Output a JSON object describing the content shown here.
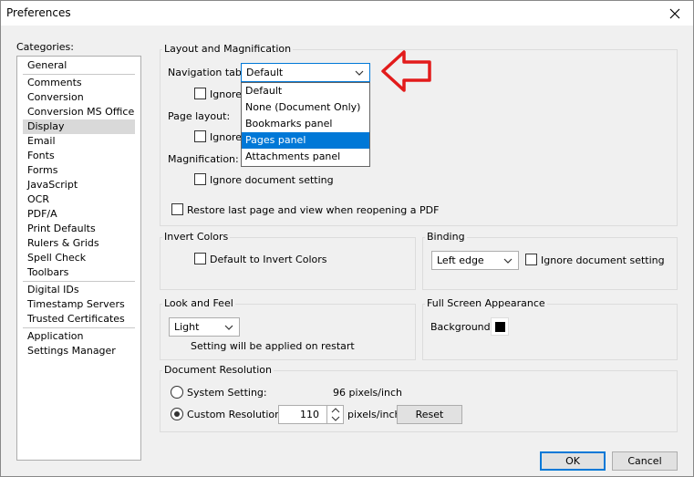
{
  "window": {
    "title": "Preferences"
  },
  "categories": {
    "label": "Categories:",
    "items": [
      "General",
      "Comments",
      "Conversion",
      "Conversion MS Office",
      "Display",
      "Email",
      "Fonts",
      "Forms",
      "JavaScript",
      "OCR",
      "PDF/A",
      "Print Defaults",
      "Rulers & Grids",
      "Spell Check",
      "Toolbars",
      "Digital IDs",
      "Timestamp Servers",
      "Trusted Certificates",
      "Application",
      "Settings Manager"
    ]
  },
  "layout": {
    "title": "Layout and Magnification",
    "nav_label": "Navigation tab:",
    "nav_value": "Default",
    "ignore_text": "Ignore",
    "page_layout_label": "Page layout:",
    "magnification_label": "Magnification:",
    "ignore_doc": "Ignore document setting",
    "restore": "Restore last page and view when reopening a PDF"
  },
  "nav_dropdown": {
    "options": [
      "Default",
      "None (Document Only)",
      "Bookmarks panel",
      "Pages panel",
      "Attachments panel"
    ],
    "selected": "Pages panel"
  },
  "invert": {
    "title": "Invert Colors",
    "label": "Default to Invert Colors"
  },
  "binding": {
    "title": "Binding",
    "value": "Left edge",
    "ignore": "Ignore document setting"
  },
  "look": {
    "title": "Look and Feel",
    "value": "Light",
    "note": "Setting will be applied on restart"
  },
  "fullscreen": {
    "title": "Full Screen Appearance",
    "background_label": "Background:",
    "background_color": "#000000"
  },
  "resolution": {
    "title": "Document Resolution",
    "system_label": "System Setting:",
    "system_value": "96 pixels/inch",
    "custom_label": "Custom Resolution:",
    "custom_value": "110",
    "unit": "pixels/inch",
    "reset": "Reset"
  },
  "footer": {
    "ok": "OK",
    "cancel": "Cancel"
  },
  "colors": {
    "accent": "#0078d7",
    "annotation_arrow": "#e21b1b"
  }
}
